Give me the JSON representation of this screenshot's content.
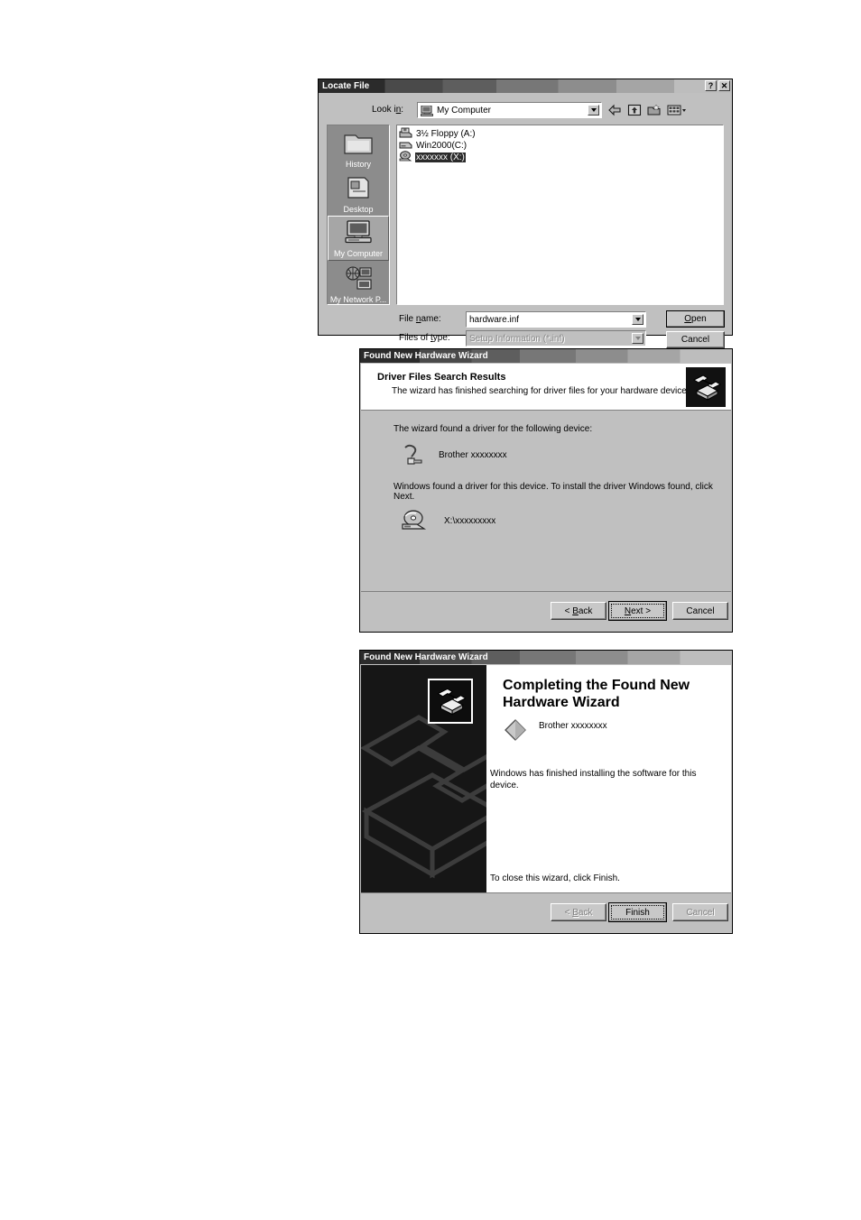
{
  "locate_file": {
    "title": "Locate File",
    "titlebar_buttons": [
      {
        "name": "help-button",
        "glyph": "?"
      },
      {
        "name": "close-button",
        "glyph": "✕"
      }
    ],
    "look_in": {
      "label": "Look in:",
      "value": "My Computer",
      "icon": "my-computer-icon"
    },
    "toolbar": [
      {
        "name": "back-icon",
        "tooltip": "Back"
      },
      {
        "name": "up-one-level-icon",
        "tooltip": "Up One Level"
      },
      {
        "name": "new-folder-icon",
        "tooltip": "Create New Folder"
      },
      {
        "name": "views-icon",
        "tooltip": "Views"
      }
    ],
    "places": [
      {
        "label": "History",
        "icon": "history-folder-icon",
        "selected": false
      },
      {
        "label": "Desktop",
        "icon": "desktop-icon",
        "selected": false
      },
      {
        "label": "My Computer",
        "icon": "my-computer-icon",
        "selected": true
      },
      {
        "label": "My Network P...",
        "icon": "network-places-icon",
        "selected": false
      }
    ],
    "files": [
      {
        "label": "3½ Floppy (A:)",
        "icon": "floppy-drive-icon",
        "selected": false
      },
      {
        "label": "Win2000(C:)",
        "icon": "hard-drive-icon",
        "selected": false
      },
      {
        "label": "xxxxxxx (X:)",
        "icon": "cd-drive-icon",
        "selected": true
      }
    ],
    "file_name": {
      "label": "File name:",
      "accel": "n",
      "value": "hardware.inf"
    },
    "files_of_type": {
      "label": "Files of type:",
      "accel": "t",
      "value": "Setup Information (*.inf)",
      "disabled": true
    },
    "open_button": "Open",
    "open_accel": "O",
    "cancel_button": "Cancel"
  },
  "wizard_search_results": {
    "title": "Found New Hardware Wizard",
    "header_title": "Driver Files Search Results",
    "header_subtitle": "The wizard has finished searching for driver files for your hardware device.",
    "header_icon": "hardware-wizard-icon",
    "line1": "The wizard found a driver for the following device:",
    "device_icon": "unknown-device-icon",
    "device_name": "Brother  xxxxxxxx",
    "line2": "Windows found a driver for this device. To install the driver Windows found, click Next.",
    "driver_icon": "cd-drive-icon",
    "driver_path": "X:\\xxxxxxxxx",
    "buttons": {
      "back": "< Back",
      "back_accel": "B",
      "next": "Next >",
      "next_accel": "N",
      "cancel": "Cancel"
    }
  },
  "wizard_complete": {
    "title": "Found New Hardware Wizard",
    "heading": "Completing the Found New Hardware Wizard",
    "wizard_icon": "hardware-wizard-icon",
    "watermark_icon": "hardware-wizard-watermark",
    "device_icon": "driver-diamond-icon",
    "device_name": "Brother xxxxxxxx",
    "message": "Windows has finished installing the software for this device.",
    "close_text": "To close this wizard, click Finish.",
    "buttons": {
      "back": "< Back",
      "back_accel": "B",
      "finish": "Finish",
      "cancel": "Cancel"
    }
  },
  "colors": {
    "dialog_face": "#c0c0c0",
    "field_bg": "#ffffff",
    "titlebar_dark": "#2b2b2b",
    "titlebar_light": "#bdbdbd",
    "selection": "#2b2b2b",
    "panel_dark": "#161616",
    "page_bg": "#ffffff"
  }
}
